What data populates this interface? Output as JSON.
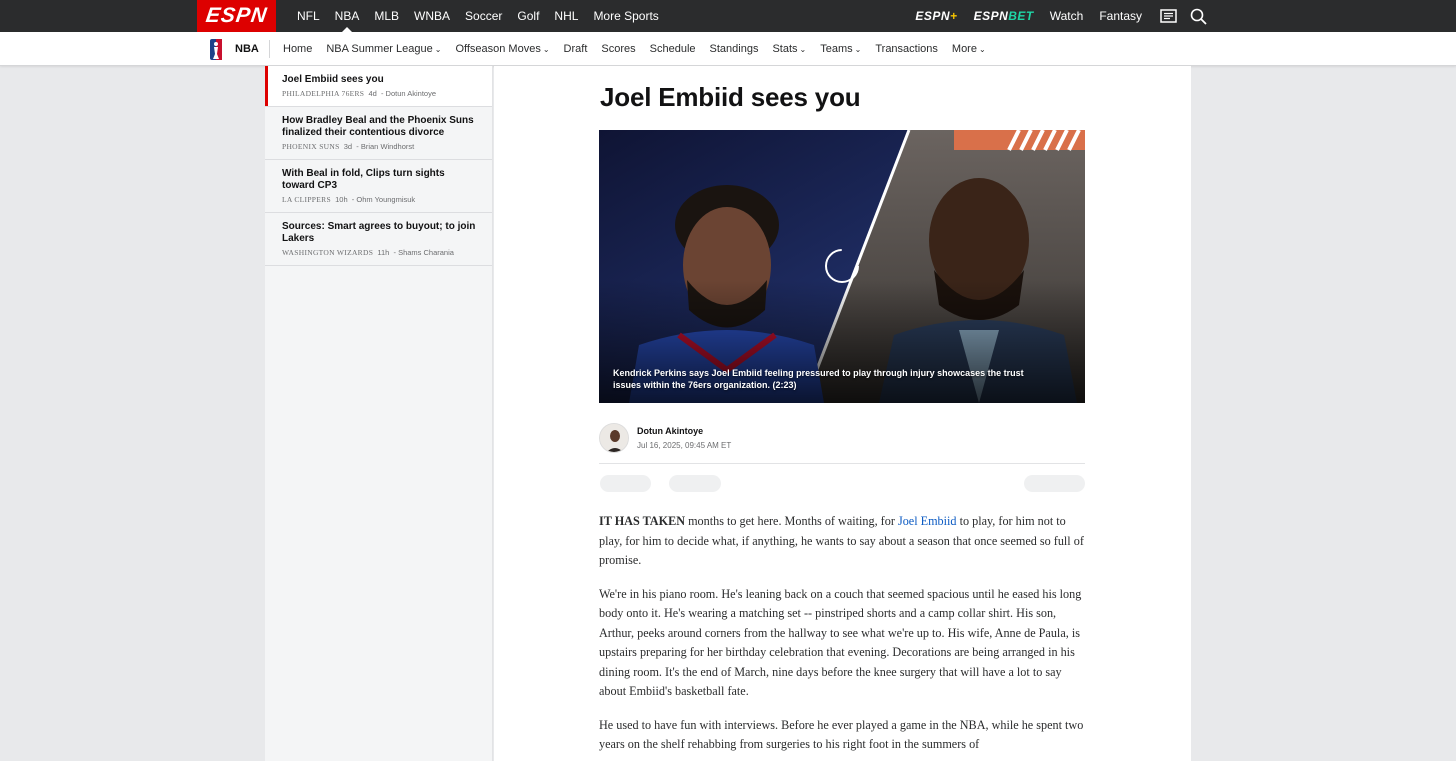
{
  "topnav": {
    "logo": "ESPN",
    "sports": [
      "NFL",
      "NBA",
      "MLB",
      "WNBA",
      "Soccer",
      "Golf",
      "NHL",
      "More Sports"
    ],
    "active_sport": "NBA",
    "espn_plus": "ESPN+",
    "espn_bet": "ESPN BET",
    "watch": "Watch",
    "fantasy": "Fantasy"
  },
  "subnav": {
    "section": "NBA",
    "links": [
      "Home",
      "NBA Summer League",
      "Offseason Moves",
      "Draft",
      "Scores",
      "Schedule",
      "Standings",
      "Stats",
      "Teams",
      "Transactions",
      "More"
    ]
  },
  "sidebar": {
    "items": [
      {
        "title": "Joel Embiid sees you",
        "team": "PHILADELPHIA 76ERS",
        "age": "4d",
        "author": "- Dotun Akintoye"
      },
      {
        "title": "How Bradley Beal and the Phoenix Suns finalized their contentious divorce",
        "team": "PHOENIX SUNS",
        "age": "3d",
        "author": "- Brian Windhorst"
      },
      {
        "title": "With Beal in fold, Clips turn sights toward CP3",
        "team": "LA CLIPPERS",
        "age": "10h",
        "author": "- Ohm Youngmisuk"
      },
      {
        "title": "Sources: Smart agrees to buyout; to join Lakers",
        "team": "WASHINGTON WIZARDS",
        "age": "11h",
        "author": "- Shams Charania"
      }
    ]
  },
  "article": {
    "headline": "Joel Embiid sees you",
    "video_caption": "Kendrick Perkins says Joel Embiid feeling pressured to play through injury showcases the trust issues within the 76ers organization. (2:23)",
    "author": "Dotun Akintoye",
    "date": "Jul 16, 2025, 09:45 AM ET",
    "p1_lead": "IT HAS TAKEN",
    "p1_a": " months to get here. Months of waiting, for ",
    "p1_link": "Joel Embiid",
    "p1_b": " to play, for him not to play, for him to decide what, if anything, he wants to say about a season that once seemed so full of promise.",
    "p2": "We're in his piano room. He's leaning back on a couch that seemed spacious until he eased his long body onto it. He's wearing a matching set -- pinstriped shorts and a camp collar shirt. His son, Arthur, peeks around corners from the hallway to see what we're up to. His wife, Anne de Paula, is upstairs preparing for her birthday celebration that evening. Decorations are being arranged in his dining room. It's the end of March, nine days before the knee surgery that will have a lot to say about Embiid's basketball fate.",
    "p3": "He used to have fun with interviews. Before he ever played a game in the NBA, while he spent two years on the shelf rehabbing from surgeries to his right foot in the summers of"
  },
  "colors": {
    "brand": "#dd0000",
    "nav_bg": "#2b2c2d",
    "link": "#0c5bc3"
  }
}
